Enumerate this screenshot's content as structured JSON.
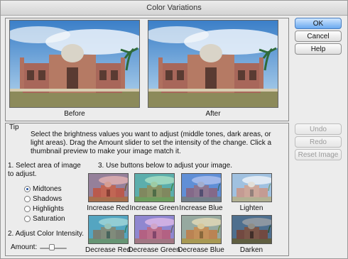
{
  "window": {
    "title": "Color Variations"
  },
  "preview": {
    "before_label": "Before",
    "after_label": "After"
  },
  "buttons": {
    "ok": "OK",
    "cancel": "Cancel",
    "help": "Help",
    "undo": "Undo",
    "redo": "Redo",
    "reset": "Reset Image"
  },
  "tip": {
    "title": "Tip",
    "text": "Select the brightness values you want to adjust (middle tones, dark areas, or light areas). Drag the Amount slider to set the intensity of the change. Click a thumbnail preview to make your image match it."
  },
  "step1": {
    "label": "1. Select area of image to adjust."
  },
  "areas": [
    {
      "label": "Midtones",
      "selected": true
    },
    {
      "label": "Shadows",
      "selected": false
    },
    {
      "label": "Highlights",
      "selected": false
    },
    {
      "label": "Saturation",
      "selected": false
    }
  ],
  "step2": {
    "label": "2. Adjust Color Intensity.",
    "amount_label": "Amount:",
    "amount_fraction": 0.45
  },
  "step3": {
    "label": "3. Use buttons below to adjust your image."
  },
  "variations": [
    {
      "label": "Increase Red",
      "tint": "#d4473a"
    },
    {
      "label": "Increase Green",
      "tint": "#3fbf6a"
    },
    {
      "label": "Increase Blue",
      "tint": "#4a6fd8"
    },
    {
      "label": "Lighten",
      "tint": "#f2f2f2"
    },
    {
      "label": "Decrease Red",
      "tint": "#2aa7a0"
    },
    {
      "label": "Decrease Green",
      "tint": "#c45ac8"
    },
    {
      "label": "Decrease Blue",
      "tint": "#d8b24a"
    },
    {
      "label": "Darken",
      "tint": "#1a1a1a"
    }
  ],
  "icons": {
    "image": "palace-photo"
  }
}
